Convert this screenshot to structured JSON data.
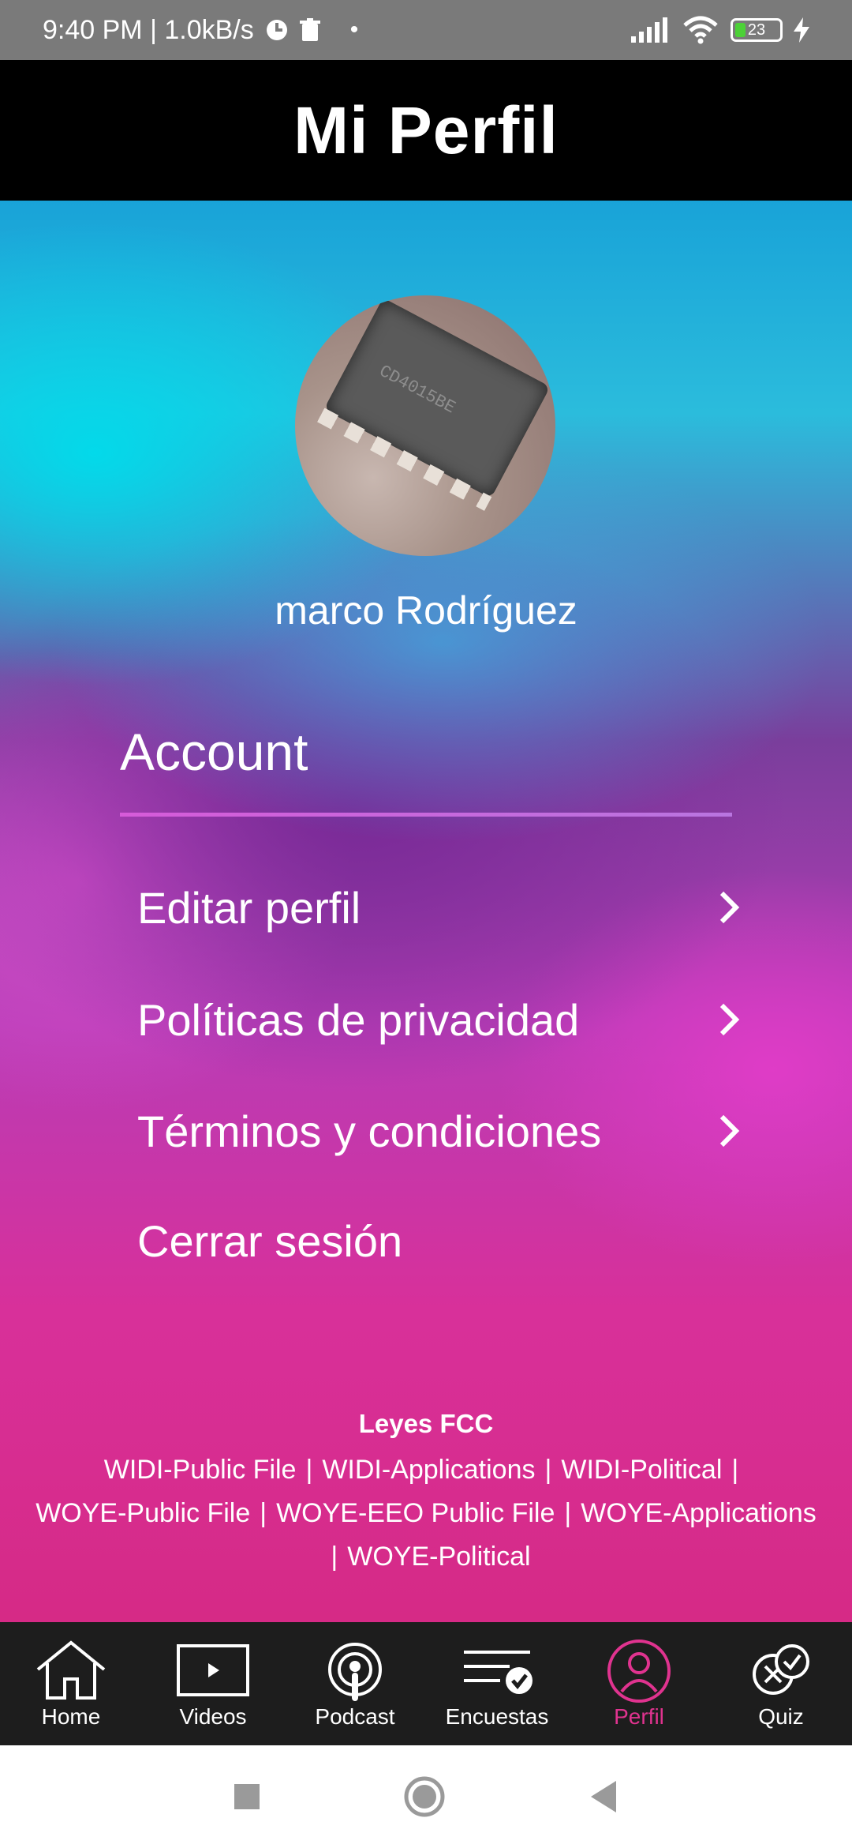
{
  "status_bar": {
    "time_speed": "9:40 PM | 1.0kB/s",
    "battery": "23"
  },
  "app_bar": {
    "title": "Mi Perfil"
  },
  "profile": {
    "name": "marco Rodríguez"
  },
  "account": {
    "title": "Account",
    "items": [
      {
        "label": "Editar perfil"
      },
      {
        "label": "Políticas de privacidad"
      },
      {
        "label": "Términos y condiciones"
      },
      {
        "label": "Cerrar sesión"
      }
    ]
  },
  "footer": {
    "title": "Leyes FCC",
    "links": [
      "WIDI-Public File",
      "WIDI-Applications",
      "WIDI-Political",
      "WOYE-Public File",
      "WOYE-EEO Public File",
      "WOYE-Applications",
      "WOYE-Political"
    ]
  },
  "bottom_nav": {
    "items": [
      {
        "label": "Home",
        "icon": "home-icon"
      },
      {
        "label": "Videos",
        "icon": "video-icon"
      },
      {
        "label": "Podcast",
        "icon": "podcast-icon"
      },
      {
        "label": "Encuestas",
        "icon": "survey-icon"
      },
      {
        "label": "Perfil",
        "icon": "user-icon"
      },
      {
        "label": "Quiz",
        "icon": "quiz-icon"
      }
    ],
    "active": "Perfil",
    "active_color": "#e0338f"
  }
}
